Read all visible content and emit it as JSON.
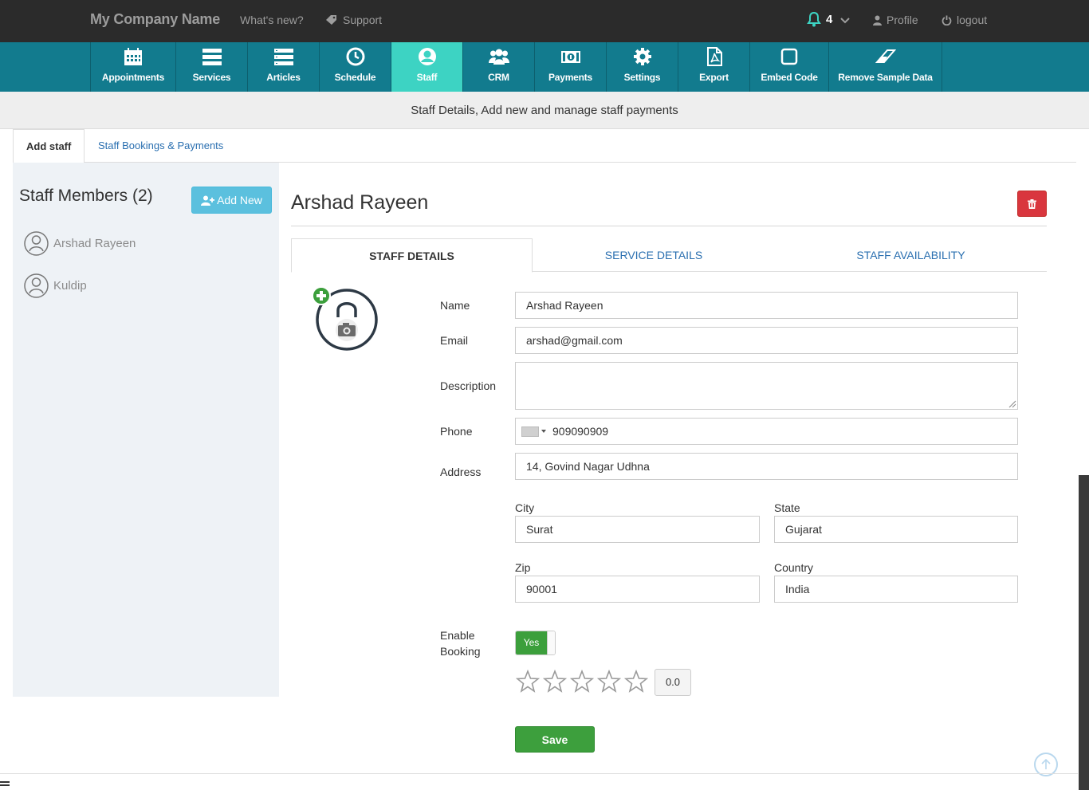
{
  "header": {
    "brand": "My Company Name",
    "whats_new": "What's new?",
    "support": "Support",
    "notification_count": "4",
    "profile": "Profile",
    "logout": "logout"
  },
  "nav": {
    "items": [
      {
        "label": "Appointments",
        "icon": "calendar-icon"
      },
      {
        "label": "Services",
        "icon": "server-icon"
      },
      {
        "label": "Articles",
        "icon": "list-icon"
      },
      {
        "label": "Schedule",
        "icon": "clock-icon"
      },
      {
        "label": "Staff",
        "icon": "user-circle-icon",
        "active": true
      },
      {
        "label": "CRM",
        "icon": "users-icon"
      },
      {
        "label": "Payments",
        "icon": "money-icon"
      },
      {
        "label": "Settings",
        "icon": "gear-icon"
      },
      {
        "label": "Export",
        "icon": "pdf-icon"
      },
      {
        "label": "Embed Code",
        "icon": "square-icon"
      },
      {
        "label": "Remove Sample Data",
        "icon": "eraser-icon"
      }
    ]
  },
  "subtitle": "Staff Details, Add new and manage staff payments",
  "page_tabs": {
    "add_staff": "Add staff",
    "bookings": "Staff Bookings & Payments"
  },
  "sidebar": {
    "title": "Staff Members (2)",
    "add_new": "Add New",
    "members": [
      "Arshad Rayeen",
      "Kuldip"
    ]
  },
  "staff": {
    "name": "Arshad Rayeen",
    "tabs": [
      "STAFF DETAILS",
      "SERVICE DETAILS",
      "STAFF AVAILABILITY"
    ]
  },
  "form": {
    "labels": {
      "name": "Name",
      "email": "Email",
      "description": "Description",
      "phone": "Phone",
      "address": "Address",
      "city": "City",
      "state": "State",
      "zip": "Zip",
      "country": "Country",
      "enable_booking_1": "Enable",
      "enable_booking_2": "Booking"
    },
    "values": {
      "name": "Arshad Rayeen",
      "email": "arshad@gmail.com",
      "description": "",
      "phone": "909090909",
      "address": "14, Govind Nagar Udhna",
      "city": "Surat",
      "state": "Gujarat",
      "zip": "90001",
      "country": "India"
    },
    "enable_booking": "Yes",
    "rating_value": "0.0",
    "rating_stars": 0,
    "save": "Save"
  },
  "colors": {
    "topbar": "#2b2b2b",
    "nav": "#127b8e",
    "nav_active": "#3dd3c3",
    "link": "#2a6fb0",
    "success": "#3d9f3d",
    "danger": "#d9363e"
  }
}
